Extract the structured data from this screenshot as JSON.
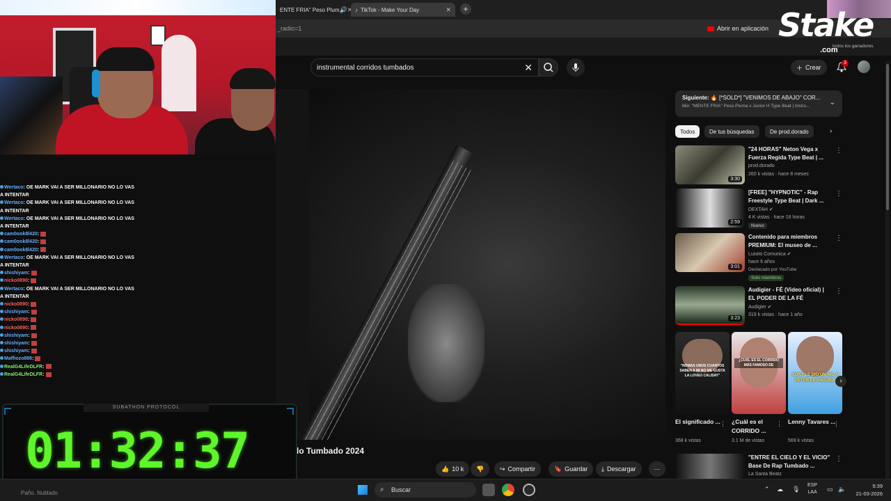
{
  "browser": {
    "tabs": [
      {
        "label": "ENTE FRIA\" Peso Plum"
      },
      {
        "label": "TikTok - Make Your Day"
      }
    ],
    "url_fragment": "_radio=1",
    "open_app_label": "Abrir en aplicación"
  },
  "youtube": {
    "search_value": "instrumental corridos tumbados",
    "create_label": "Crear",
    "notif_count": "3",
    "video_title_partial": "lo Tumbado 2024",
    "actions": {
      "likes": "10 k",
      "share": "Compartir",
      "save": "Guardar",
      "download": "Descargar"
    },
    "next": {
      "label": "Siguiente:",
      "title": "[*SOLD*] \"VENIMOS DE ABAJO\" COR...",
      "subtitle": "Mix: \"MENTE FRIA\" Peso Pluma x Junior H Type Beat | Instru..."
    },
    "chips": [
      "Todos",
      "De tus búsquedas",
      "De prod.dorado"
    ],
    "recommendations": [
      {
        "title": "\"24 HORAS\" Neton Vega x Fuerza Regida Type Beat | ...",
        "channel": "prod.dorado",
        "meta": "260 k vistas · hace 8 meses",
        "duration": "3:30",
        "extra": ""
      },
      {
        "title": "[FREE] \"HYPNOTIC\" - Rap Freestyle Type Beat | Dark ...",
        "channel": "DEXTAH",
        "meta": "4 K vistas · hace 16 horas",
        "duration": "2:59",
        "extra": "Nuevo"
      },
      {
        "title": "Contenido para miembros PREMIUM: El museo de ...",
        "channel": "Luisito Comunica",
        "meta": "hace 6 años",
        "duration": "3:01",
        "extra": "Destacado por YouTube",
        "extra2": "Solo miembros"
      },
      {
        "title": "Audigier - FÉ (Video oficial) | EL PODER DE LA FÉ",
        "channel": "Audigier",
        "meta": "319 k vistas · hace 1 año",
        "duration": "3:23",
        "extra": ""
      },
      {
        "title": "\"ENTRE EL CIELO Y EL VICIO\" Base De Rap Tumbado ...",
        "channel": "La Santa Beatz",
        "meta": "",
        "duration": "",
        "extra": ""
      }
    ],
    "shorts": [
      {
        "title": "El significado ...",
        "views": "368 k vistas",
        "overlay": "\"NOMAS UNOS CUANTOS SABEN A MI NO ME GUSTA LA LOVEO CALISAY\""
      },
      {
        "title": "¿Cuál es el CORRIDO ...",
        "views": "3.1 M de vistas",
        "overlay": "¿CUÁL ES EL CORRIDO MÁS FAMOSO DE"
      },
      {
        "title": "Lenny Tavares ...",
        "views": "569 k vistas",
        "overlay": "SONY LE DIÓ UN MIL A PETER LA ANGUILA"
      }
    ]
  },
  "chat": [
    {
      "user": "Wertaco",
      "msg": ": OE MARK VAI A SER MILLONARIO NO LO VAS",
      "cont": "A INTENTAR",
      "color": "blue"
    },
    {
      "user": "Wertaco",
      "msg": ": OE MARK VAI A SER MILLONARIO NO LO VAS",
      "cont": "A INTENTAR",
      "color": "blue"
    },
    {
      "user": "Wertaco",
      "msg": ": OE MARK VAI A SER MILLONARIO NO LO VAS",
      "cont": "A INTENTAR",
      "color": "blue"
    },
    {
      "user": "cam0ook8l420",
      "msg": ":",
      "cont": "",
      "color": "blue"
    },
    {
      "user": "cam0ook8l420",
      "msg": ":",
      "cont": "",
      "color": "blue"
    },
    {
      "user": "cam0ook8l420",
      "msg": ":",
      "cont": "",
      "color": "blue"
    },
    {
      "user": "Wertaco",
      "msg": ": OE MARK VAI A SER MILLONARIO NO LO VAS",
      "cont": "A INTENTAR",
      "color": "blue"
    },
    {
      "user": "shishiyam",
      "msg": ":",
      "cont": "",
      "color": "blue"
    },
    {
      "user": "nicko0890",
      "msg": ":",
      "cont": "",
      "color": "red"
    },
    {
      "user": "Wertaco",
      "msg": ": OE MARK VAI A SER MILLONARIO NO LO VAS",
      "cont": "A INTENTAR",
      "color": "blue"
    },
    {
      "user": "nicko0890",
      "msg": ":",
      "cont": "",
      "color": "red"
    },
    {
      "user": "shishiyam",
      "msg": ":",
      "cont": "",
      "color": "blue"
    },
    {
      "user": "nicko0890",
      "msg": ":",
      "cont": "",
      "color": "red"
    },
    {
      "user": "nicko0890",
      "msg": ":",
      "cont": "",
      "color": "red"
    },
    {
      "user": "shishiyam",
      "msg": ":",
      "cont": "",
      "color": "blue"
    },
    {
      "user": "shishiyam",
      "msg": ":",
      "cont": "",
      "color": "blue"
    },
    {
      "user": "shishiyam",
      "msg": ":",
      "cont": "",
      "color": "blue"
    },
    {
      "user": "Maffiozo898",
      "msg": ":",
      "cont": "",
      "color": "blue"
    },
    {
      "user": "RealG4LifeDLFR",
      "msg": ":",
      "cont": "",
      "color": "green"
    },
    {
      "user": "RealG4LifeDLFR",
      "msg": ":",
      "cont": "",
      "color": "green"
    }
  ],
  "timer": {
    "header": "SUBATHON PROTOCOL",
    "value": "01:32:37"
  },
  "stake": {
    "brand": "Stake",
    "tld": ".com",
    "sub": "todos los ganadores"
  },
  "taskbar": {
    "search_placeholder": "Buscar",
    "lang": "ESP",
    "lang2": "LAA",
    "time": "5:39",
    "date": "21-03-2026",
    "hidden_text": "Paño. Nublado"
  },
  "colors": {
    "yt_bg": "#0f0f0f",
    "timer_green": "#5ef52a",
    "yt_red": "#ff0000"
  }
}
